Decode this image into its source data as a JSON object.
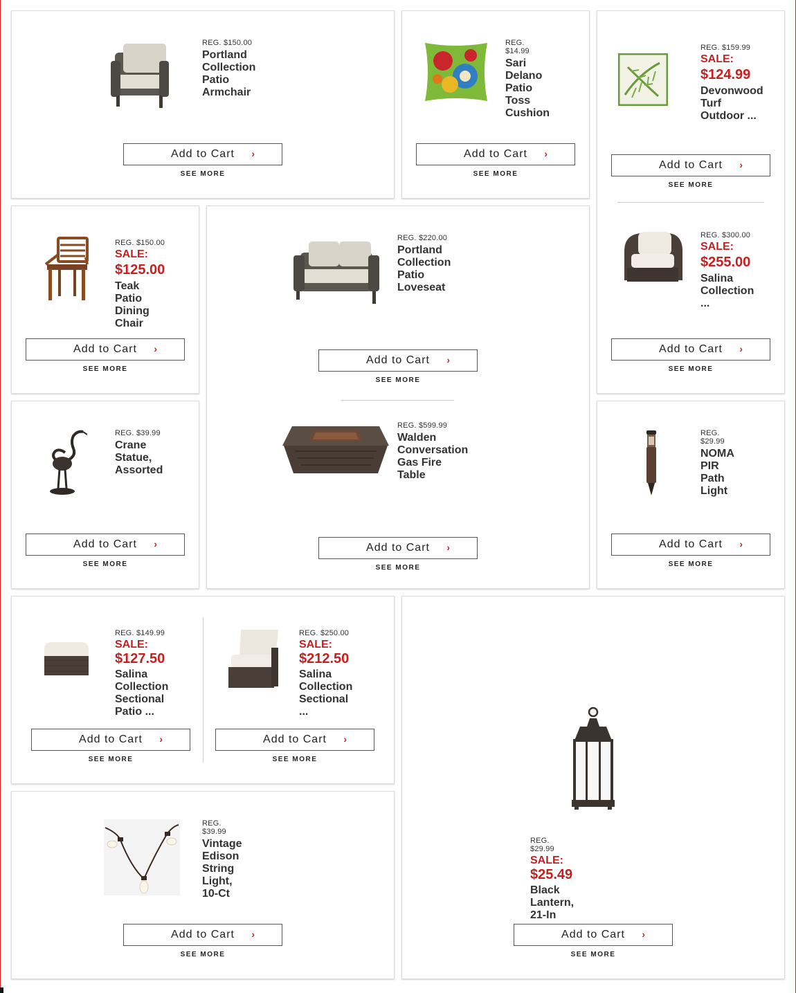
{
  "common": {
    "add_to_cart": "Add to Cart",
    "see_more": "SEE MORE",
    "chevron": "›"
  },
  "products": {
    "armchair": {
      "reg": "REG. $150.00",
      "name1": "Portland Collection",
      "name2": "Patio Armchair"
    },
    "cushion": {
      "reg": "REG. $14.99",
      "name1": "Sari Delano",
      "name2": "Patio Toss",
      "name3": "Cushion"
    },
    "turf": {
      "reg": "REG. $159.99",
      "sale_label": "SALE:",
      "sale_price": "$124.99",
      "name1": "Devonwood",
      "name2": "Turf Outdoor ..."
    },
    "teak": {
      "reg": "REG. $150.00",
      "sale_label": "SALE:",
      "sale_price": "$125.00",
      "name1": "Teak Patio",
      "name2": "Dining Chair"
    },
    "loveseat": {
      "reg": "REG. $220.00",
      "name1": "Portland Collection",
      "name2": "Patio Loveseat"
    },
    "salina": {
      "reg": "REG. $300.00",
      "sale_label": "SALE:",
      "sale_price": "$255.00",
      "name1": "Salina",
      "name2": "Collection ..."
    },
    "crane": {
      "reg": "REG. $39.99",
      "name1": "Crane Statue,",
      "name2": "Assorted"
    },
    "firetable": {
      "reg": "REG. $599.99",
      "name1": "Walden Conversation",
      "name2": "Gas Fire Table"
    },
    "pathlight": {
      "reg": "REG. $29.99",
      "name1": "NOMA PIR",
      "name2": "Path Light"
    },
    "ottoman": {
      "reg": "REG. $149.99",
      "sale_label": "SALE:",
      "sale_price": "$127.50",
      "name1": "Salina Collection",
      "name2": "Sectional Patio ..."
    },
    "sectional": {
      "reg": "REG. $250.00",
      "sale_label": "SALE:",
      "sale_price": "$212.50",
      "name1": "Salina Collection",
      "name2": "Sectional ..."
    },
    "edison": {
      "reg": "REG. $39.99",
      "name1": "Vintage Edison String",
      "name2": "Light, 10-Ct"
    },
    "lantern": {
      "reg": "REG. $29.99",
      "sale_label": "SALE:",
      "sale_price": "$25.49",
      "name1": "Black Lantern, 21-In"
    }
  },
  "colors": {
    "sale_red": "#c81e1e",
    "border": "#dcdcdc",
    "accent_red": "#d21f1f"
  }
}
